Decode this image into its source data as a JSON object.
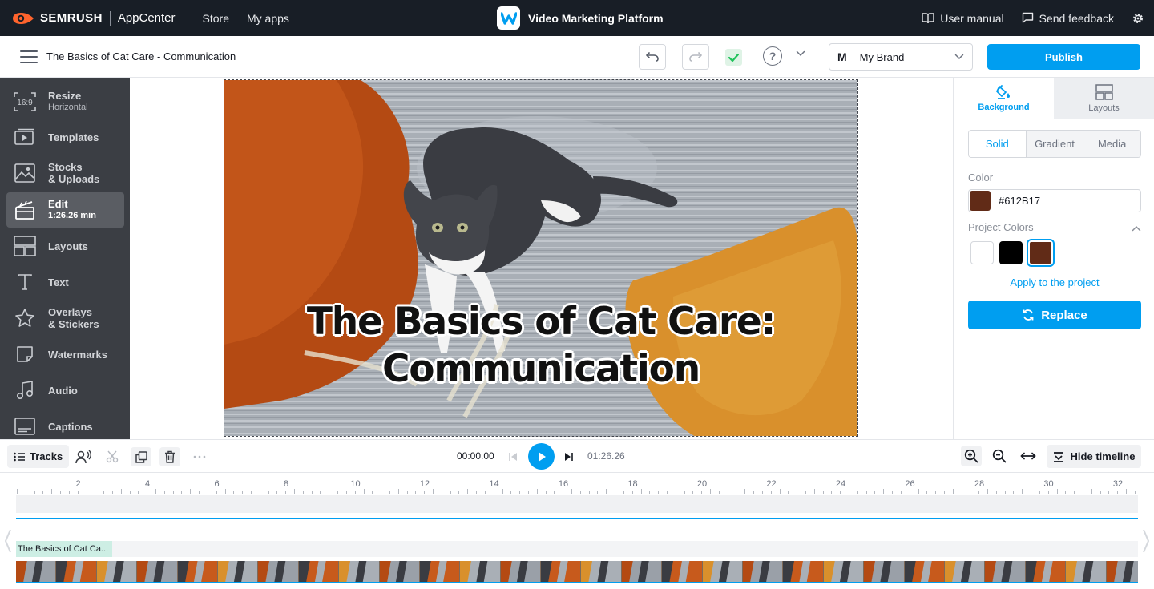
{
  "topbar": {
    "brand": "SEMRUSH",
    "app_center": "AppCenter",
    "nav": [
      "Store",
      "My apps"
    ],
    "product_name": "Video Marketing Platform",
    "user_manual": "User manual",
    "send_feedback": "Send feedback"
  },
  "editor": {
    "doc_title": "The Basics of Cat Care - Communication",
    "brand_select_initial": "M",
    "brand_select_value": "My Brand",
    "publish_label": "Publish",
    "help_glyph": "?"
  },
  "sidebar": {
    "items": [
      {
        "label": "Resize",
        "sub": "Horizontal",
        "icon": "resize-icon",
        "icon_text": "16:9"
      },
      {
        "label": "Templates",
        "icon": "templates-icon"
      },
      {
        "label": "Stocks",
        "label2": "& Uploads",
        "icon": "stocks-icon"
      },
      {
        "label": "Edit",
        "sub": "1:26.26 min",
        "icon": "edit-icon"
      },
      {
        "label": "Layouts",
        "icon": "layouts-icon"
      },
      {
        "label": "Text",
        "icon": "text-icon"
      },
      {
        "label": "Overlays",
        "label2": "& Stickers",
        "icon": "overlays-icon"
      },
      {
        "label": "Watermarks",
        "icon": "watermarks-icon"
      },
      {
        "label": "Audio",
        "icon": "audio-icon"
      },
      {
        "label": "Captions",
        "icon": "captions-icon"
      }
    ],
    "active_index": 3
  },
  "canvas": {
    "title_line1": "The Basics of Cat Care:",
    "title_line2": "Communication"
  },
  "right_panel": {
    "tabs": [
      "Background",
      "Layouts"
    ],
    "active_tab": "Background",
    "segments": [
      "Solid",
      "Gradient",
      "Media"
    ],
    "active_segment": "Solid",
    "color_label": "Color",
    "color_hex": "#612B17",
    "project_colors_label": "Project Colors",
    "project_colors": [
      "#ffffff",
      "#000000",
      "#612b17"
    ],
    "selected_project_color": "#612b17",
    "apply_label": "Apply to the project",
    "replace_label": "Replace"
  },
  "timeline_toolbar": {
    "tracks_label": "Tracks",
    "current_time": "00:00.00",
    "total_time": "01:26.26",
    "hide_timeline_label": "Hide timeline"
  },
  "timeline": {
    "ruler_labels": [
      "2",
      "4",
      "6",
      "8",
      "10",
      "12",
      "14",
      "16",
      "18",
      "20",
      "22",
      "24",
      "26",
      "28",
      "30",
      "32"
    ],
    "text_clip_label": "The Basics of Cat Ca..."
  },
  "colors": {
    "accent": "#009ef0",
    "topbar_bg": "#181e26",
    "sidebar_bg": "#3b3e44",
    "semrush_orange": "#ff642d",
    "check_green": "#1ec25a"
  }
}
